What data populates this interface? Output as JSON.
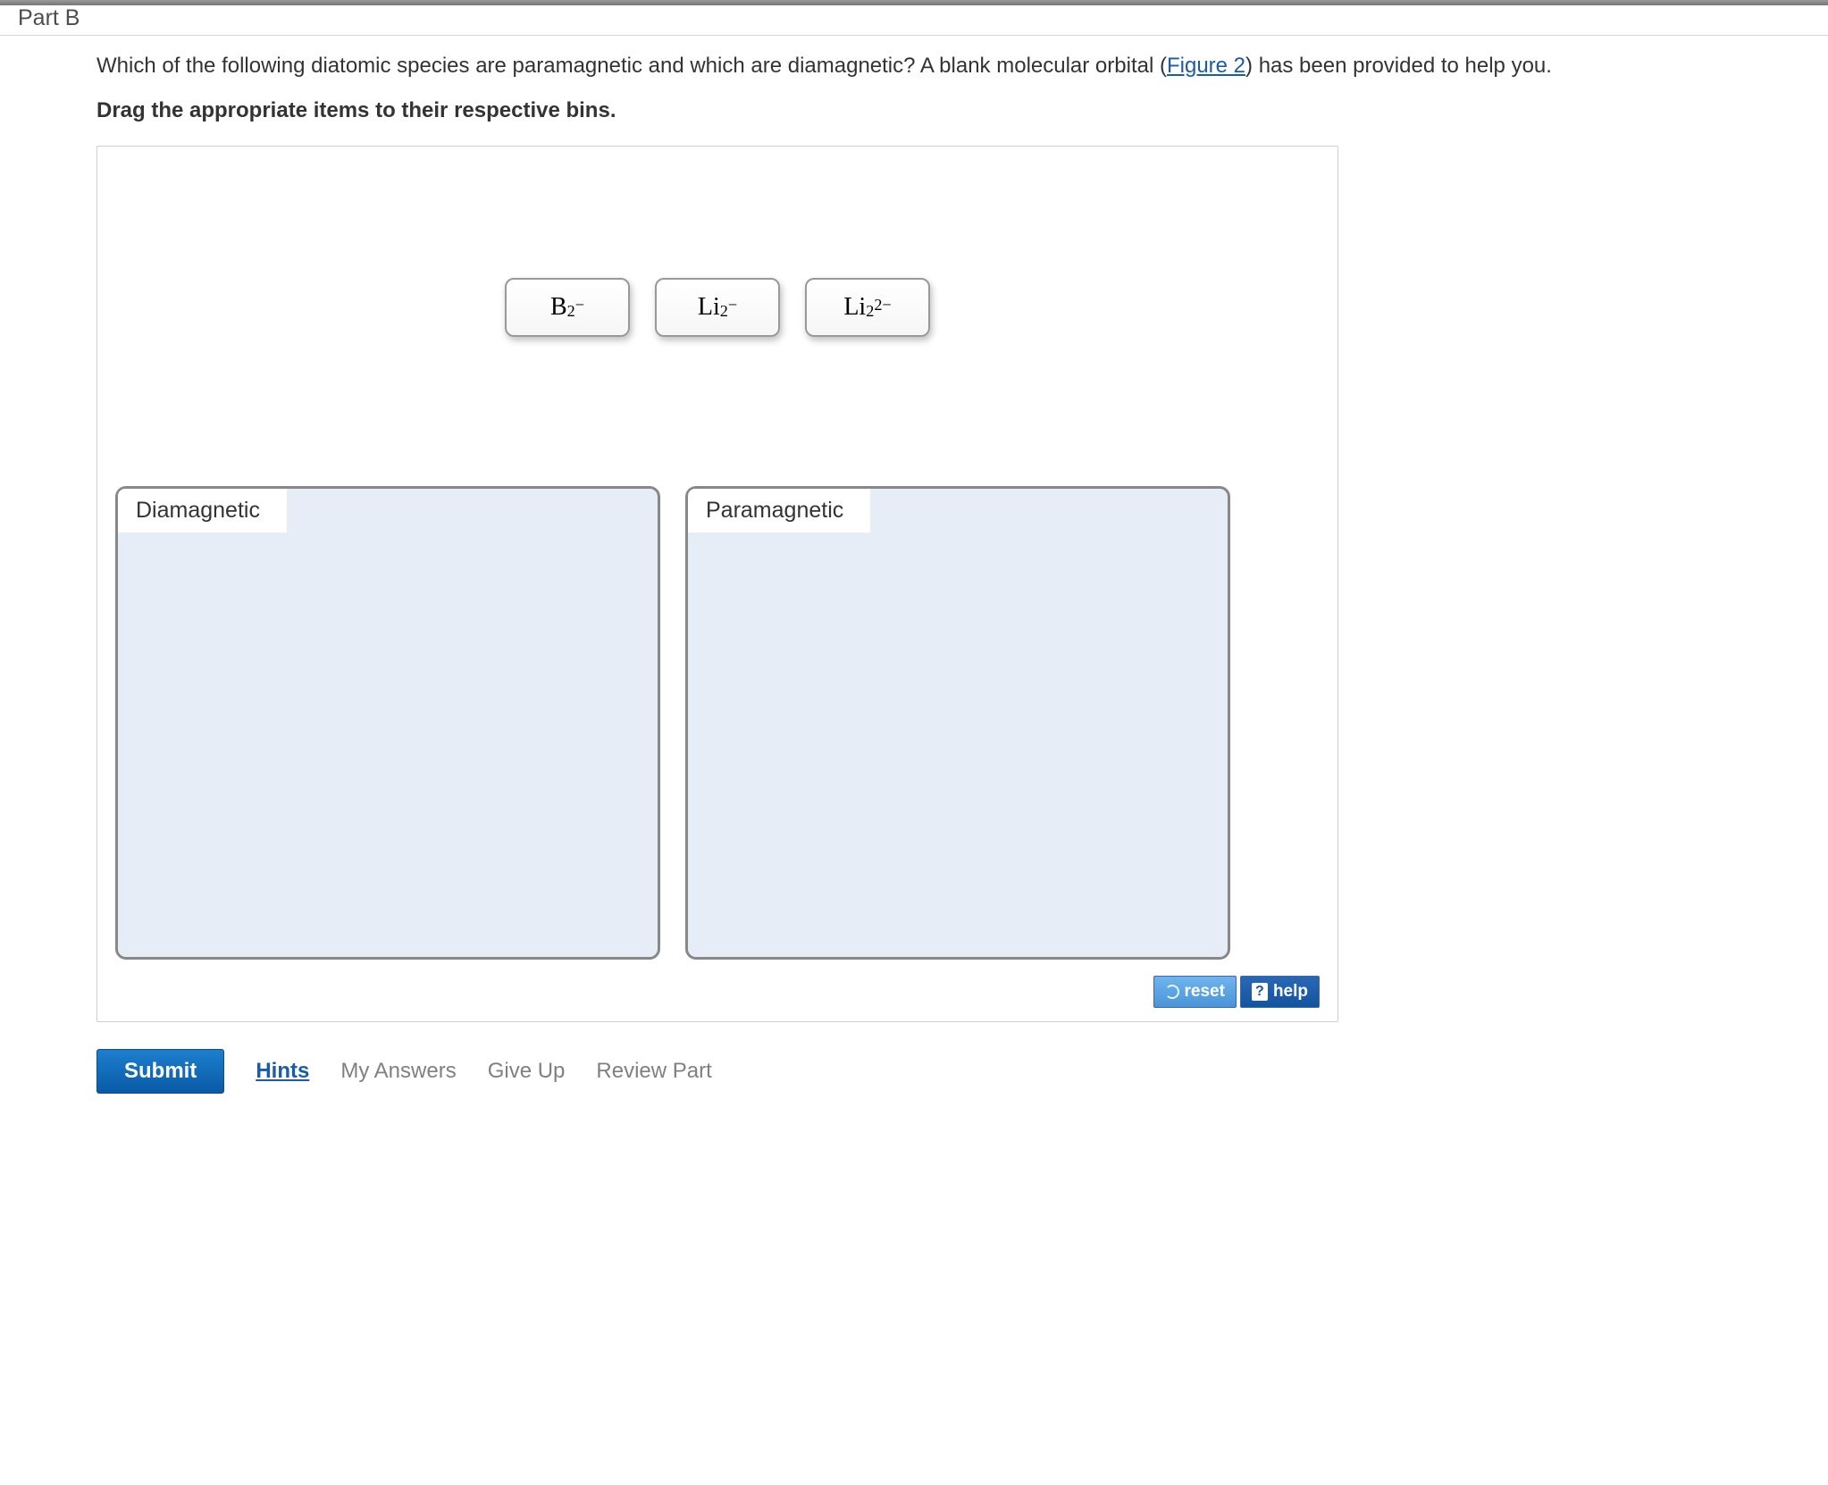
{
  "part": {
    "label": "Part B"
  },
  "question": {
    "text_part1": "Which of the following diatomic species are paramagnetic and which are diamagnetic? A blank molecular orbital",
    "link_text": "Figure 2",
    "text_part2": ") has been provided to help you.",
    "instruction": "Drag the appropriate items to their respective bins."
  },
  "items": [
    {
      "base": "B",
      "sub": "2",
      "sup": "−"
    },
    {
      "base": "Li",
      "sub": "2",
      "sup": "−"
    },
    {
      "base": "Li",
      "sub": "2",
      "sup": "2−"
    }
  ],
  "bins": [
    {
      "label": "Diamagnetic"
    },
    {
      "label": "Paramagnetic"
    }
  ],
  "controls": {
    "reset": "reset",
    "help": "help"
  },
  "actions": {
    "submit": "Submit",
    "hints": "Hints",
    "my_answers": "My Answers",
    "give_up": "Give Up",
    "review_part": "Review Part"
  }
}
